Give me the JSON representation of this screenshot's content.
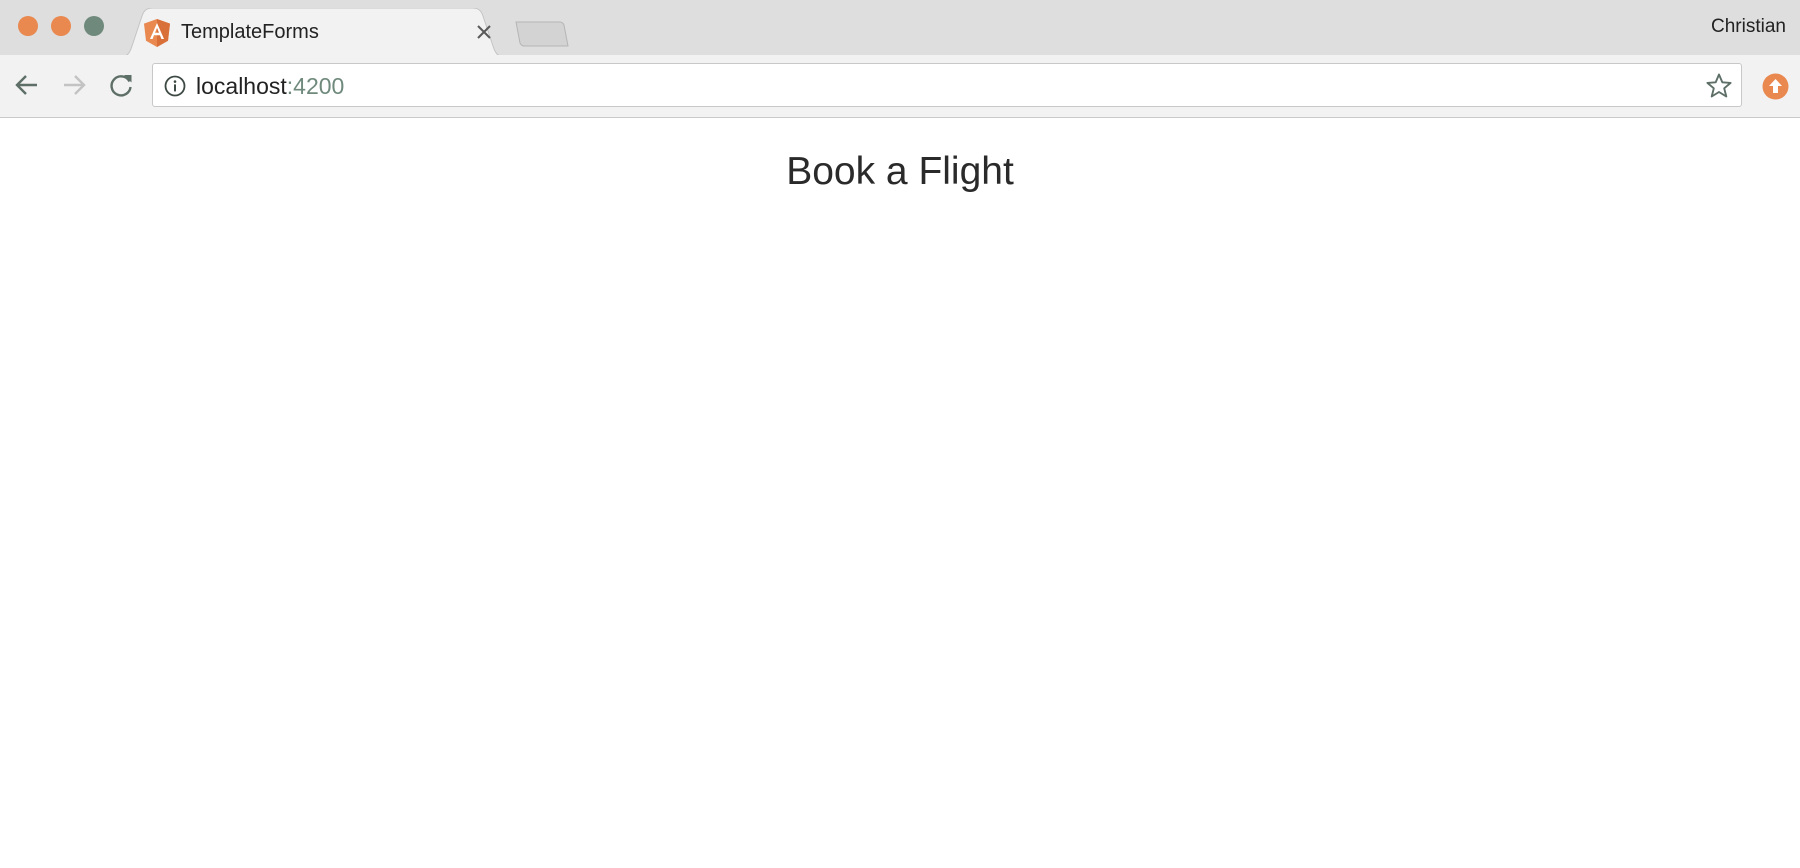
{
  "window": {
    "traffic_lights": {
      "close_color": "#e9884f",
      "minimize_color": "#e9884f",
      "zoom_color": "#6f8a7c"
    },
    "profile_name": "Christian"
  },
  "tabs": [
    {
      "title": "TemplateForms",
      "favicon": "angular-icon",
      "active": true
    }
  ],
  "toolbar": {
    "address": {
      "host": "localhost",
      "port": ":4200"
    },
    "icons": {
      "back": "back-arrow-icon",
      "forward": "forward-arrow-icon",
      "reload": "reload-icon",
      "info": "info-icon",
      "bookmark": "star-icon",
      "extension": "upload-arrow-icon"
    }
  },
  "page": {
    "title": "Book a Flight"
  },
  "colors": {
    "accent": "#e9884f",
    "muted_green": "#6f8a7c",
    "tab_strip": "#dedede",
    "toolbar": "#f2f2f2"
  }
}
